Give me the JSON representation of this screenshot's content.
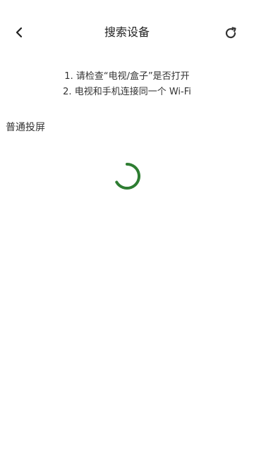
{
  "header": {
    "title": "搜索设备",
    "back_icon": "chevron-left-icon",
    "refresh_icon": "refresh-icon"
  },
  "tips": {
    "line1": "1. 请检查“电视/盒子”是否打开",
    "line2": "2. 电视和手机连接同一个 Wi-Fi"
  },
  "section": {
    "title": "普通投屏"
  },
  "colors": {
    "spinner": "#2e7d32",
    "text": "#333333",
    "background": "#ffffff"
  }
}
